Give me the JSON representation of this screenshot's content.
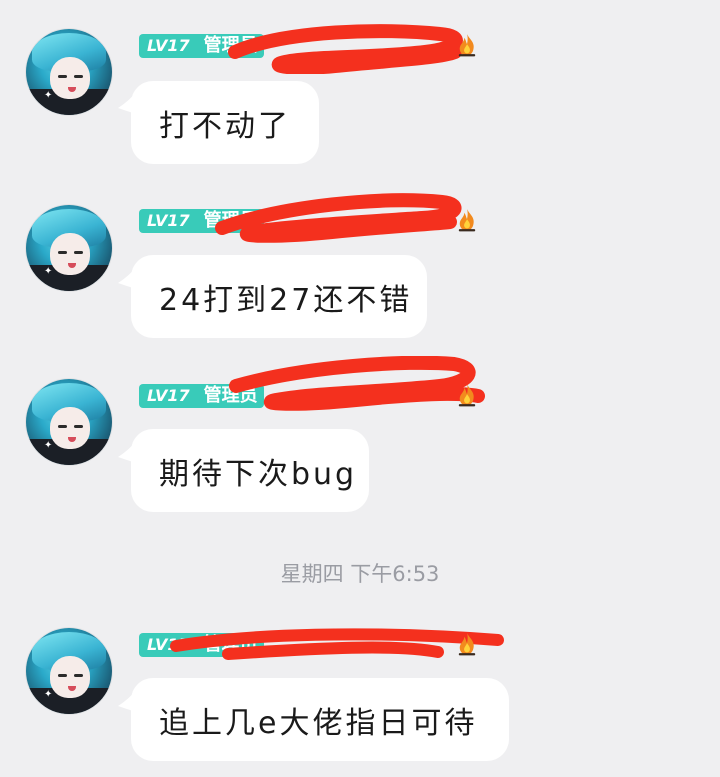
{
  "messages": [
    {
      "level": "LV17",
      "role": "管理员",
      "text": "打不动了"
    },
    {
      "level": "LV17",
      "role": "管理员",
      "text": "24打到27还不错"
    },
    {
      "level": "LV17",
      "role": "管理员",
      "text": "期待下次bug"
    },
    {
      "level": "LV17",
      "role": "管理员",
      "text": "追上几e大佬指日可待"
    }
  ],
  "timestamp": "星期四 下午6:53",
  "colors": {
    "background": "#efeff1",
    "badge": "#39cbb9",
    "bubble": "#ffffff",
    "redaction": "#f4301e",
    "timestamp": "#9a9ca3"
  },
  "icons": {
    "badge_flair": "fire-icon",
    "avatar": "anime-avatar"
  }
}
